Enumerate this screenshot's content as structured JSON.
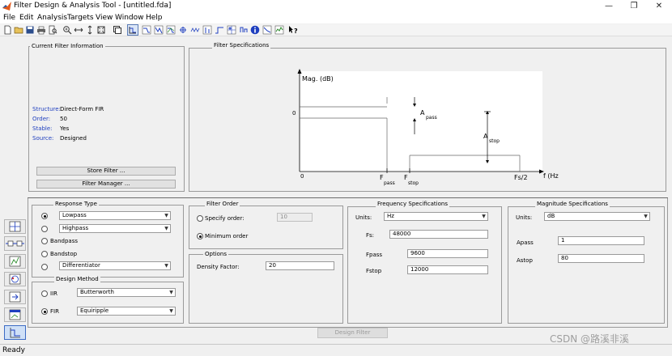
{
  "window": {
    "title": "Filter Design & Analysis Tool - [untitled.fda]",
    "controls": {
      "minimize": "—",
      "maximize": "❐",
      "close": "✕"
    }
  },
  "menu": [
    "File",
    "Edit",
    "Analysis",
    "Targets",
    "View",
    "Window",
    "Help"
  ],
  "toolbar": {
    "icons": [
      "new-file-icon",
      "open-file-icon",
      "save-icon",
      "print-icon",
      "print-preview-icon",
      "zoom-in-icon",
      "zoom-x-icon",
      "zoom-y-icon",
      "full-view-icon",
      "new-window-icon",
      "filter-specifications-icon",
      "magnitude-response-icon",
      "phase-response-icon",
      "magnitude-phase-icon",
      "group-delay-icon",
      "phase-delay-icon",
      "impulse-response-icon",
      "step-response-icon",
      "pole-zero-icon",
      "filter-coefficients-icon",
      "filter-information-icon",
      "magnitude-response-estimate-icon",
      "round-off-noise-icon",
      "whats-this-icon"
    ]
  },
  "current_filter": {
    "title": "Current Filter Information",
    "rows": [
      {
        "label": "Structure:",
        "value": "Direct-Form FIR"
      },
      {
        "label": "Order:",
        "value": "50"
      },
      {
        "label": "Stable:",
        "value": "Yes"
      },
      {
        "label": "Source:",
        "value": "Designed"
      }
    ],
    "store_button": "Store Filter ...",
    "manager_button": "Filter Manager ..."
  },
  "filter_specifications": {
    "title": "Filter Specifications",
    "ylabel": "Mag. (dB)",
    "xlabel": "f (Hz)",
    "y_zero": "0",
    "x_zero": "0",
    "fpass": {
      "main": "F",
      "sub": "pass"
    },
    "fstop": {
      "main": "F",
      "sub": "stop"
    },
    "fs2": "Fs/2",
    "apass": {
      "main": "A",
      "sub": "pass"
    },
    "astop": {
      "main": "A",
      "sub": "stop"
    }
  },
  "response_type": {
    "title": "Response Type",
    "lowpass": "Lowpass",
    "highpass": "Highpass",
    "bandpass": "Bandpass",
    "bandstop": "Bandstop",
    "differentiator": "Differentiator",
    "selected": "Lowpass"
  },
  "design_method": {
    "title": "Design Method",
    "iir_label": "IIR",
    "iir_value": "Butterworth",
    "fir_label": "FIR",
    "fir_value": "Equiripple",
    "selected": "FIR"
  },
  "filter_order": {
    "title": "Filter Order",
    "specify_label": "Specify order:",
    "specify_value": "10",
    "minimum_label": "Minimum order",
    "selected": "Minimum order"
  },
  "options": {
    "title": "Options",
    "density_label": "Density Factor:",
    "density_value": "20"
  },
  "frequency_specifications": {
    "title": "Frequency Specifications",
    "units_label": "Units:",
    "units_value": "Hz",
    "fs_label": "Fs:",
    "fs_value": "48000",
    "fpass_label": "Fpass",
    "fpass_value": "9600",
    "fstop_label": "Fstop",
    "fstop_value": "12000"
  },
  "magnitude_specifications": {
    "title": "Magnitude Specifications",
    "units_label": "Units:",
    "units_value": "dB",
    "apass_label": "Apass",
    "apass_value": "1",
    "astop_label": "Astop",
    "astop_value": "80"
  },
  "design_button": "Design Filter",
  "status": "Ready",
  "watermark": "CSDN @路溪非溪",
  "sidebar": {
    "icons": [
      "transform-filter-icon",
      "create-multirate-filter-icon",
      "realize-model-icon",
      "pole-zero-editor-icon",
      "import-filter-icon",
      "design-filter-icon"
    ]
  }
}
